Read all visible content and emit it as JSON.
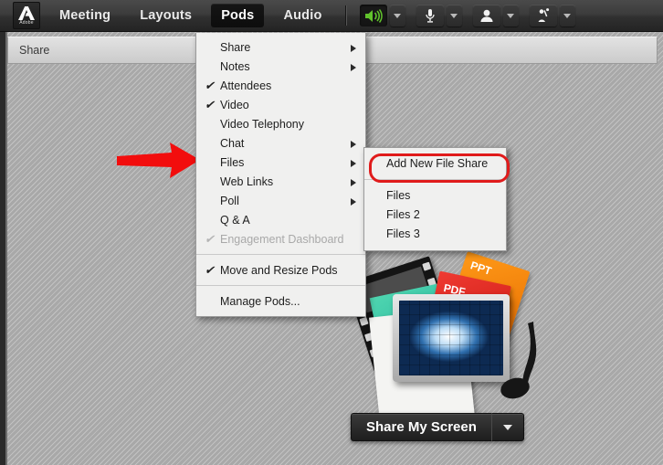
{
  "app": {
    "brand": "Adobe",
    "brand_icon": "adobe-logo-icon"
  },
  "menubar": {
    "items": [
      {
        "label": "Meeting",
        "active": false
      },
      {
        "label": "Layouts",
        "active": false
      },
      {
        "label": "Pods",
        "active": true
      },
      {
        "label": "Audio",
        "active": false
      }
    ],
    "toolbar": [
      {
        "icon": "speaker-icon",
        "state": "on",
        "color": "#5fc12e"
      },
      {
        "icon": "microphone-icon",
        "state": "off"
      },
      {
        "icon": "webcam-icon",
        "state": "off"
      },
      {
        "icon": "raise-hand-icon",
        "state": "off"
      }
    ],
    "dropdown_caret_icon": "chevron-down-icon"
  },
  "sharebar": {
    "title": "Share"
  },
  "pods_menu": {
    "items": [
      {
        "label": "Share",
        "checked": false,
        "submenu": true,
        "disabled": false
      },
      {
        "label": "Notes",
        "checked": false,
        "submenu": true,
        "disabled": false
      },
      {
        "label": "Attendees",
        "checked": true,
        "submenu": false,
        "disabled": false
      },
      {
        "label": "Video",
        "checked": true,
        "submenu": false,
        "disabled": false
      },
      {
        "label": "Video Telephony",
        "checked": false,
        "submenu": false,
        "disabled": false
      },
      {
        "label": "Chat",
        "checked": false,
        "submenu": true,
        "disabled": false
      },
      {
        "label": "Files",
        "checked": false,
        "submenu": true,
        "disabled": false
      },
      {
        "label": "Web Links",
        "checked": false,
        "submenu": true,
        "disabled": false
      },
      {
        "label": "Poll",
        "checked": false,
        "submenu": true,
        "disabled": false
      },
      {
        "label": "Q & A",
        "checked": false,
        "submenu": false,
        "disabled": false
      },
      {
        "label": "Engagement Dashboard",
        "checked": true,
        "submenu": false,
        "disabled": true
      },
      {
        "label": "Move and Resize Pods",
        "checked": true,
        "submenu": false,
        "disabled": false
      },
      {
        "label": "Manage Pods...",
        "checked": false,
        "submenu": false,
        "disabled": false
      }
    ],
    "checkmark_glyph": "✔"
  },
  "files_submenu": {
    "items": [
      {
        "label": "Add New File Share",
        "highlighted": true
      },
      {
        "label": "Files",
        "highlighted": false
      },
      {
        "label": "Files 2",
        "highlighted": false
      },
      {
        "label": "Files 3",
        "highlighted": false
      }
    ],
    "highlight_color": "#e01b1b"
  },
  "annotation": {
    "arrow_icon": "red-right-arrow-annotation",
    "arrow_color": "#f20d0d",
    "points_to": "Files"
  },
  "share_placeholder": {
    "media_labels": {
      "ppt": "PPT",
      "pdf": "PDF"
    },
    "graphics": [
      "film-strip-icon",
      "photo-frame-icon",
      "music-note-icon",
      "ppt-document-icon",
      "pdf-document-icon"
    ]
  },
  "share_button": {
    "label": "Share My Screen",
    "caret_icon": "chevron-down-icon"
  }
}
